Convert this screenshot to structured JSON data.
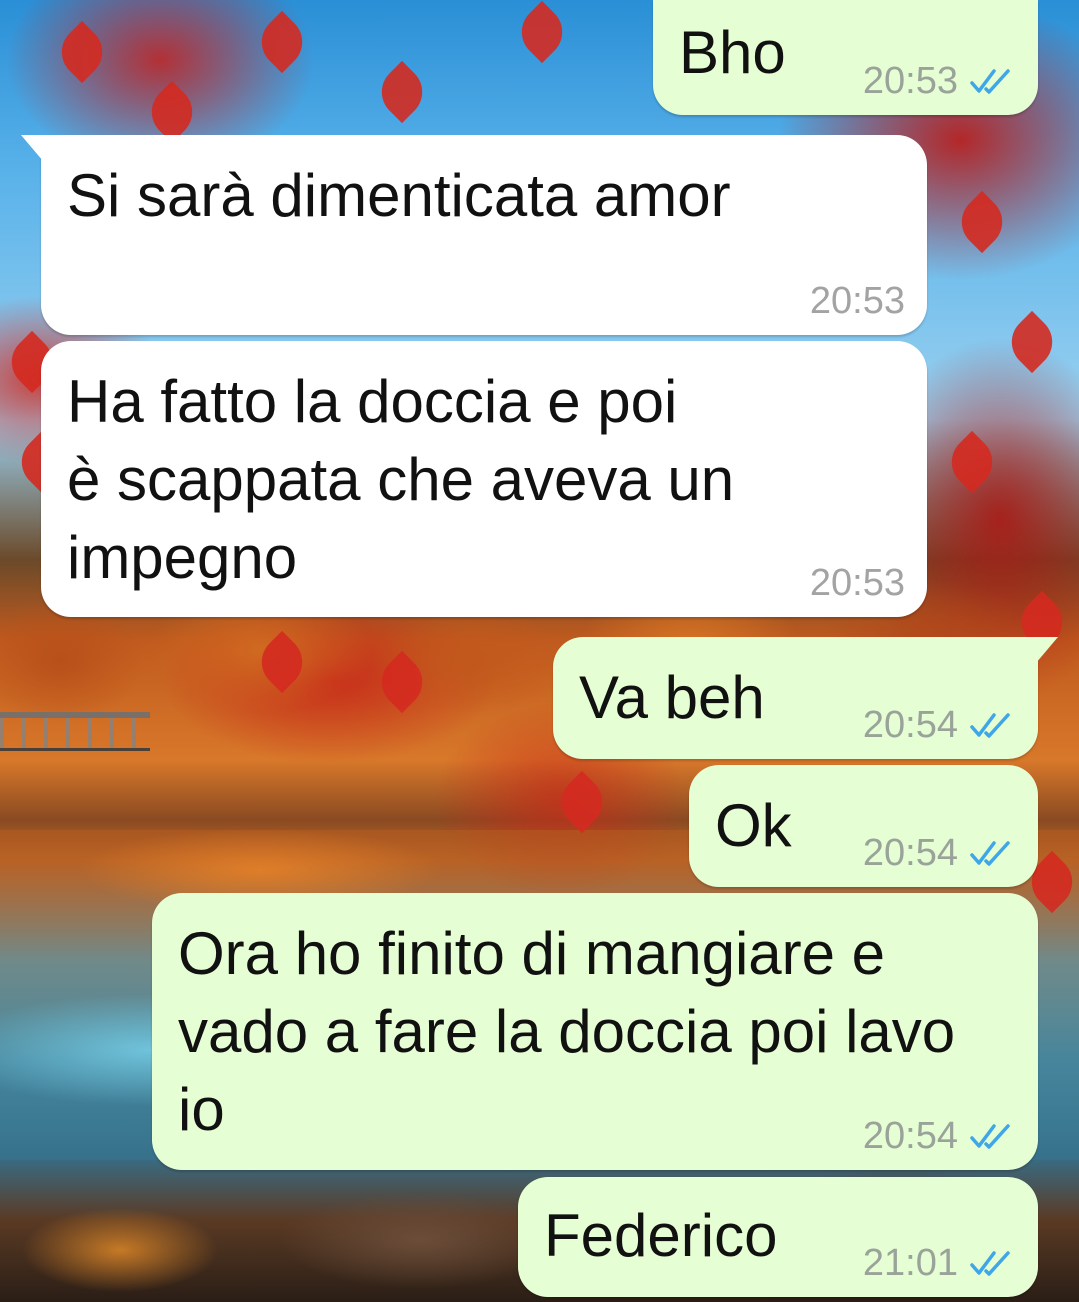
{
  "conversation": {
    "messages": [
      {
        "direction": "outgoing",
        "text": "Bho",
        "time": "20:53",
        "status_icon": "double-check-read-icon"
      },
      {
        "direction": "incoming",
        "text": "Si sarà dimenticata amor",
        "time": "20:53"
      },
      {
        "direction": "incoming",
        "text": "Ha fatto la doccia e poi\nè scappata che aveva un\nimpegno",
        "time": "20:53"
      },
      {
        "direction": "outgoing",
        "text": "Va beh",
        "time": "20:54",
        "status_icon": "double-check-read-icon"
      },
      {
        "direction": "outgoing",
        "text": "Ok",
        "time": "20:54",
        "status_icon": "double-check-read-icon"
      },
      {
        "direction": "outgoing",
        "text": "Ora ho finito di mangiare e\nvado a fare la doccia poi lavo\nio",
        "time": "20:54",
        "status_icon": "double-check-read-icon"
      },
      {
        "direction": "outgoing",
        "text": "Federico",
        "time": "21:01",
        "status_icon": "double-check-read-icon"
      }
    ]
  },
  "colors": {
    "incoming_bubble": "#ffffff",
    "outgoing_bubble": "#e6fed4",
    "read_ticks": "#3fa6e8",
    "timestamp": "#9aa39a"
  }
}
